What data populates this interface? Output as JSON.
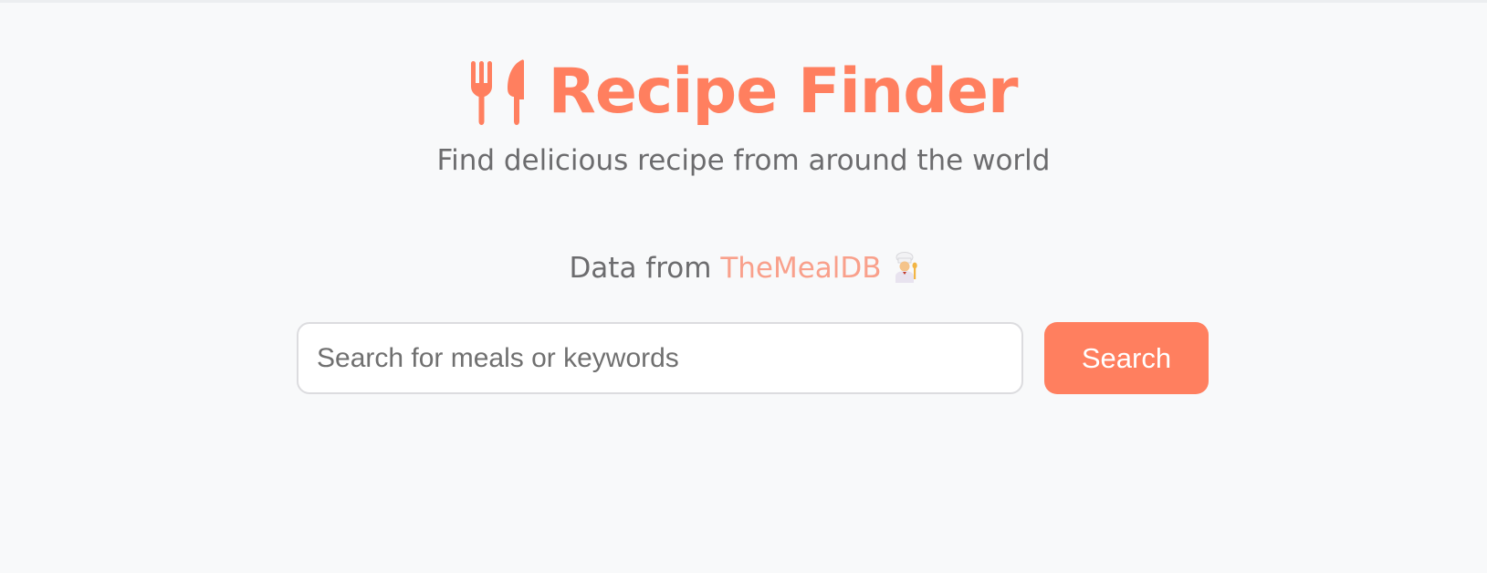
{
  "header": {
    "icon": "fork-knife-icon",
    "title": "Recipe Finder",
    "subtitle": "Find delicious recipe from around the world"
  },
  "credit": {
    "prefix": "Data from ",
    "link_text": "TheMealDB",
    "icon": "chef-icon"
  },
  "search": {
    "placeholder": "Search for meals or keywords",
    "value": "",
    "button_label": "Search"
  },
  "colors": {
    "accent": "#ff7f5f",
    "link": "#f9a08b",
    "text_muted": "#6c6c6e",
    "background": "#f8f9fa"
  }
}
